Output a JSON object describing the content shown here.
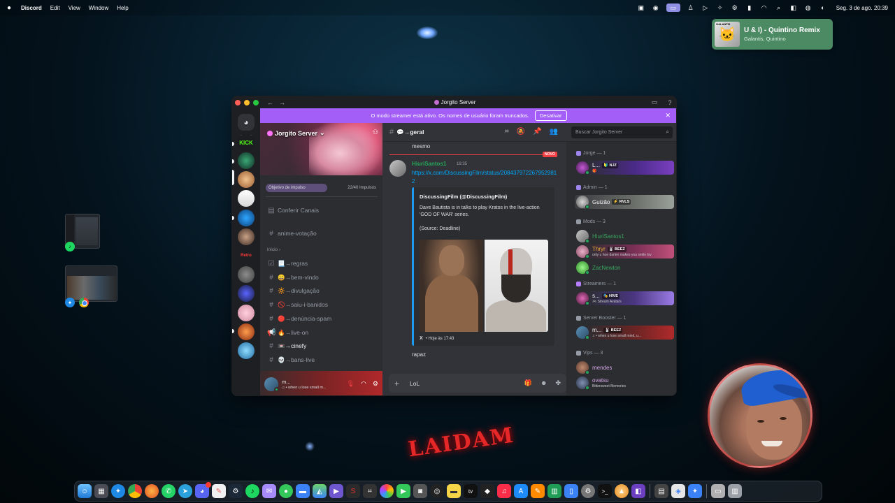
{
  "menubar": {
    "app_name": "Discord",
    "menus": [
      "Edit",
      "View",
      "Window",
      "Help"
    ],
    "clock": "Seg. 3 de ago.  20:39"
  },
  "now_playing": {
    "art_label": "GALANTIS",
    "title": "U & I) - Quintino Remix",
    "artist": "Galantis, Quintino"
  },
  "wallpaper": {
    "neon_text": "LAIDAM"
  },
  "discord": {
    "window_title": "Jorgito Server",
    "streamer_banner": {
      "text": "O modo streamer está ativo. Os nomes de usuário foram truncados.",
      "button": "Desativar"
    },
    "server": {
      "name": "Jorgito Server",
      "boost_goal_label": "Objetivo de impulso",
      "boost_count": "22/40 Impulsos",
      "boost_progress": 0.55
    },
    "rail": {
      "kick_label": "KICK",
      "retro_label": "Retro"
    },
    "channels": {
      "browse": "Conferir Canais",
      "top_channel": "anime-votação",
      "category": "início",
      "items": [
        {
          "icon": "rules",
          "name": "📃→regras"
        },
        {
          "icon": "hash",
          "name": "😀→bem-vindo"
        },
        {
          "icon": "hash",
          "name": "🔆→divulgação"
        },
        {
          "icon": "hash",
          "name": "🚫→saiu-i-banidos"
        },
        {
          "icon": "hash",
          "name": "🔴→denúncia-spam"
        },
        {
          "icon": "announce",
          "name": "🔥→live-on"
        },
        {
          "icon": "hash",
          "name": "📼→cinefy"
        },
        {
          "icon": "hash",
          "name": "💀→bans-live"
        }
      ]
    },
    "user_panel": {
      "name": "m...",
      "status": "♫ • when u lose small m..."
    },
    "chat": {
      "channel_name": "💬→geral",
      "search_placeholder": "Buscar Jorgito Server",
      "prev_message": "mesmo",
      "new_label": "NOVO",
      "author": "HiuriSantos1",
      "time": "18:35",
      "link": "https://x.com/DiscussingFilm/status/2084379722679529812",
      "embed": {
        "author": "DiscussingFilm (@DiscussingFilm)",
        "description": "Dave Bautista is in talks to play Kratos in the live-action 'GOD OF WAR' series.",
        "source": "(Source: Deadline)",
        "footer_platform": "X",
        "footer_time": "• Hoje às 17:43"
      },
      "next_message": "rapaz",
      "composer_text": "LoL"
    },
    "members": {
      "categories": [
        {
          "label": "Jorge — 1",
          "color": "#9b84ec"
        },
        {
          "label": "Admin — 1",
          "color": "#9b84ec"
        },
        {
          "label": "Mods — 3",
          "color": "#949ba4"
        },
        {
          "label": "Streamers — 1",
          "color": "#b57eff"
        },
        {
          "label": "Server Booster — 1",
          "color": "#949ba4"
        },
        {
          "label": "Vips — 3",
          "color": "#949ba4"
        }
      ],
      "list": [
        {
          "name": "L...",
          "tag": "🔰 NJZ",
          "sub": "🎁",
          "color": "#f2f3f5"
        },
        {
          "name": "Guizão",
          "tag": "⚡ RVLS",
          "sub": "",
          "color": "#f2f3f5"
        },
        {
          "name": "HiuriSantos1",
          "tag": "",
          "sub": "",
          "color": "#3ba55c"
        },
        {
          "name": "Thryr",
          "tag": "🐰 BEEZ",
          "sub": "only u hoe darlen makes you smile lov",
          "color": "#f0b232"
        },
        {
          "name": "ZacNewton",
          "tag": "",
          "sub": "",
          "color": "#3ba55c"
        },
        {
          "name": "s...",
          "tag": "🎭 HIVE",
          "sub": "🎮 Stream Avatars",
          "color": "#f2f3f5"
        },
        {
          "name": "m...",
          "tag": "🐰 BEEZ",
          "sub": "♫ • when u lose small mind, u...",
          "color": "#f2f3f5"
        },
        {
          "name": "mendes",
          "tag": "",
          "sub": "",
          "color": "#d5a6e6"
        },
        {
          "name": "ovatsu",
          "tag": "",
          "sub": "Bittersweet Memories",
          "color": "#d5a6e6"
        }
      ]
    }
  },
  "dock": {
    "apps": [
      "Finder",
      "Launchpad",
      "Safari",
      "Chrome",
      "Firefox",
      "WhatsApp",
      "Telegram",
      "Discord",
      "Pages",
      "Steam",
      "Spotify",
      "Mail",
      "Messages",
      "Notes",
      "Maps",
      "Notion",
      "Screenshot",
      "Photos",
      "FaceTime",
      "Trash-cam",
      "Activity",
      "Notes2",
      "TV",
      "Shortcuts",
      "Music",
      "App Store",
      "Sublime",
      "Numbers",
      "Preview",
      "Settings",
      "Terminal",
      "Cobalt",
      "Nova",
      "Downloads",
      "Bin"
    ]
  }
}
